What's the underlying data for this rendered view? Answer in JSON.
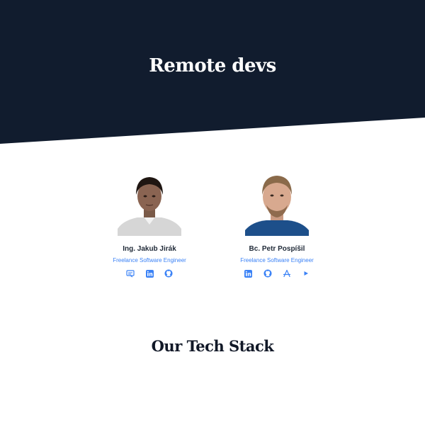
{
  "hero": {
    "title": "Remote devs",
    "bg_color": "#111c2e"
  },
  "team": [
    {
      "name": "Ing. Jakub Jirák",
      "role": "Freelance Software Engineer",
      "links": [
        "website-icon",
        "linkedin-icon",
        "github-icon"
      ]
    },
    {
      "name": "Bc. Petr Pospíšil",
      "role": "Freelance Software Engineer",
      "links": [
        "linkedin-icon",
        "github-icon",
        "app-store-icon",
        "google-play-icon"
      ]
    }
  ],
  "tech_stack": {
    "title": "Our Tech Stack"
  },
  "colors": {
    "accent": "#3b82f6",
    "heading": "#111827"
  }
}
